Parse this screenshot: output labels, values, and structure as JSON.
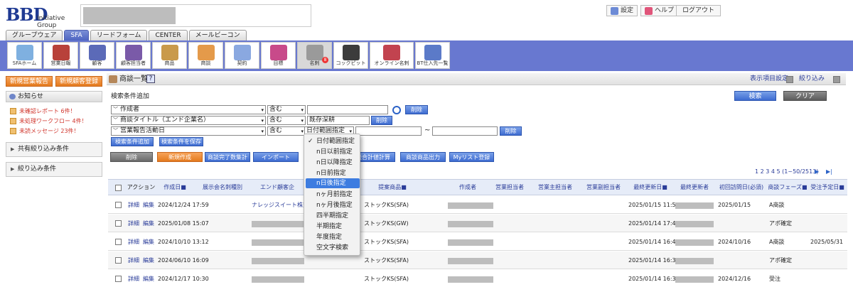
{
  "header": {
    "logo_text": "BBD",
    "logo_tagline": "Initiative Group",
    "settings_label": "設定",
    "help_label": "ヘルプ",
    "logout_label": "ログアウト"
  },
  "tabs": [
    {
      "label": "グループウェア"
    },
    {
      "label": "SFA"
    },
    {
      "label": "リードフォーム"
    },
    {
      "label": "CENTER"
    },
    {
      "label": "メールビーコン"
    }
  ],
  "nav": [
    {
      "label": "SFAホーム"
    },
    {
      "label": "営業日報"
    },
    {
      "label": "顧客"
    },
    {
      "label": "顧客担当者"
    },
    {
      "label": "商品"
    },
    {
      "label": "商談"
    },
    {
      "label": "契約"
    },
    {
      "label": "目標"
    },
    {
      "label": "名刺",
      "badge": "8"
    },
    {
      "label": "コックピット"
    },
    {
      "label": "オンライン名刺"
    },
    {
      "label": "BT仕入先一覧"
    }
  ],
  "left": {
    "new_report": "新規営業報告",
    "new_customer": "新規顧客登録",
    "notice_title": "お知らせ",
    "notices": [
      {
        "text": "未確認レポート 6件！"
      },
      {
        "text": "未処理ワークフロー 4件！"
      },
      {
        "text": "未読メッセージ 23件！"
      }
    ],
    "shared_filters": "共有絞り込み条件",
    "filters": "絞り込み条件"
  },
  "main": {
    "title": "商談一覧",
    "display_settings": "表示項目設定",
    "narrow": "絞り込み",
    "cond_add_label": "検索条件追加",
    "search_label": "検索",
    "clear_label": "クリア",
    "conditions": [
      {
        "field": "作成者",
        "op": "含む",
        "value": "",
        "delete": "削除"
      },
      {
        "field": "商談タイトル（エンド企業名）",
        "op": "含む",
        "value": "既存深耕",
        "delete": "削除"
      },
      {
        "field": "営業報告活動日",
        "op": "含む",
        "value": "日付範囲指定",
        "tilde": "~",
        "delete": "削除"
      }
    ],
    "add_condition": "検索条件追加",
    "save_condition": "検索条件を保存",
    "actions": {
      "delete": "削除",
      "new": "新規作成",
      "sum_complete": "商談完了数集計",
      "import": "インポート",
      "total_calc": "談合計値計算",
      "product_output": "商談商品出力",
      "mylist": "Myリスト登録"
    },
    "pagination": {
      "pages": "1 2 3 4 5 (1~50/2513)",
      "next": "▶",
      "last": "▶|"
    }
  },
  "dropdown": {
    "items": [
      {
        "label": "日付範囲指定",
        "checked": true
      },
      {
        "label": "n日以前指定"
      },
      {
        "label": "n日以降指定"
      },
      {
        "label": "n日前指定"
      },
      {
        "label": "n日後指定",
        "highlighted": true
      },
      {
        "label": "nヶ月前指定"
      },
      {
        "label": "nヶ月後指定"
      },
      {
        "label": "四半期指定"
      },
      {
        "label": "半期指定"
      },
      {
        "label": "年度指定"
      },
      {
        "label": "空文字検索"
      }
    ]
  },
  "table": {
    "headers": {
      "action": "アクション",
      "created": "作成日",
      "exhibit": "展示会名刺種別",
      "end_customer": "エンド顧客企",
      "product": "提案商品",
      "author": "作成者",
      "sales_rep": "営業担当者",
      "sales_main": "営業主担当者",
      "sales_sub": "営業副担当者",
      "last_updated": "最終更新日",
      "last_updater": "最終更新者",
      "first_visit": "初回訪問日(必須)",
      "phase": "商談フェーズ",
      "order_date": "受注予定日"
    },
    "detail_label": "詳細",
    "edit_label": "編集",
    "rows": [
      {
        "created": "2024/12/24 17:59",
        "end_customer": "ナレッジスイート株式",
        "product": "ストックKS(SFA)",
        "updated": "2025/01/15 11:56",
        "first_visit": "2025/01/15",
        "phase": "A商談",
        "order": ""
      },
      {
        "created": "2025/01/08 15:07",
        "end_customer": "",
        "product": "ストックKS(GW)",
        "updated": "2025/01/14 17:43",
        "first_visit": "",
        "phase": "アポ確定",
        "order": ""
      },
      {
        "created": "2024/10/10 13:12",
        "end_customer": "",
        "product": "ストックKS(SFA)",
        "updated": "2025/01/14 16:43",
        "first_visit": "2024/10/16",
        "phase": "A商談",
        "order": "2025/05/31"
      },
      {
        "created": "2024/06/10 16:09",
        "end_customer": "",
        "product": "ストックKS(SFA)",
        "updated": "2025/01/14 16:39",
        "first_visit": "",
        "phase": "アポ確定",
        "order": ""
      },
      {
        "created": "2024/12/17 10:30",
        "end_customer": "",
        "product": "ストックKS(SFA)",
        "updated": "2025/01/14 16:38",
        "first_visit": "2024/12/16",
        "phase": "受注",
        "order": ""
      }
    ]
  },
  "colors": {
    "nav_band": "#6878d0",
    "accent_blue": "#3e6cd1",
    "orange": "#e47a1e",
    "link": "#2a3c99"
  }
}
